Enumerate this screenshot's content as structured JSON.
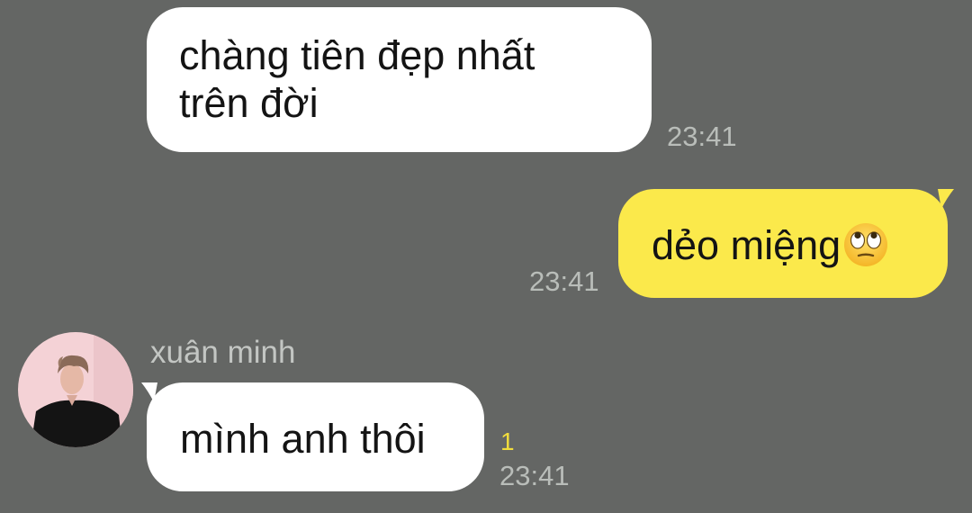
{
  "chat": {
    "messages": [
      {
        "direction": "incoming",
        "text_line1": "chàng tiên đẹp nhất",
        "text_line2": "trên đời",
        "time": "23:41"
      },
      {
        "direction": "outgoing",
        "text": "dẻo miệng",
        "emoji": "face-with-rolling-eyes",
        "time": "23:41"
      },
      {
        "direction": "incoming",
        "sender": "xuân minh",
        "text": "mình anh thôi",
        "unread_count": "1",
        "time": "23:41"
      }
    ]
  },
  "colors": {
    "background": "#646664",
    "incoming_bubble": "#ffffff",
    "outgoing_bubble": "#fbe94b",
    "timestamp": "#b9bdb9",
    "unread": "#f1dd3c"
  }
}
